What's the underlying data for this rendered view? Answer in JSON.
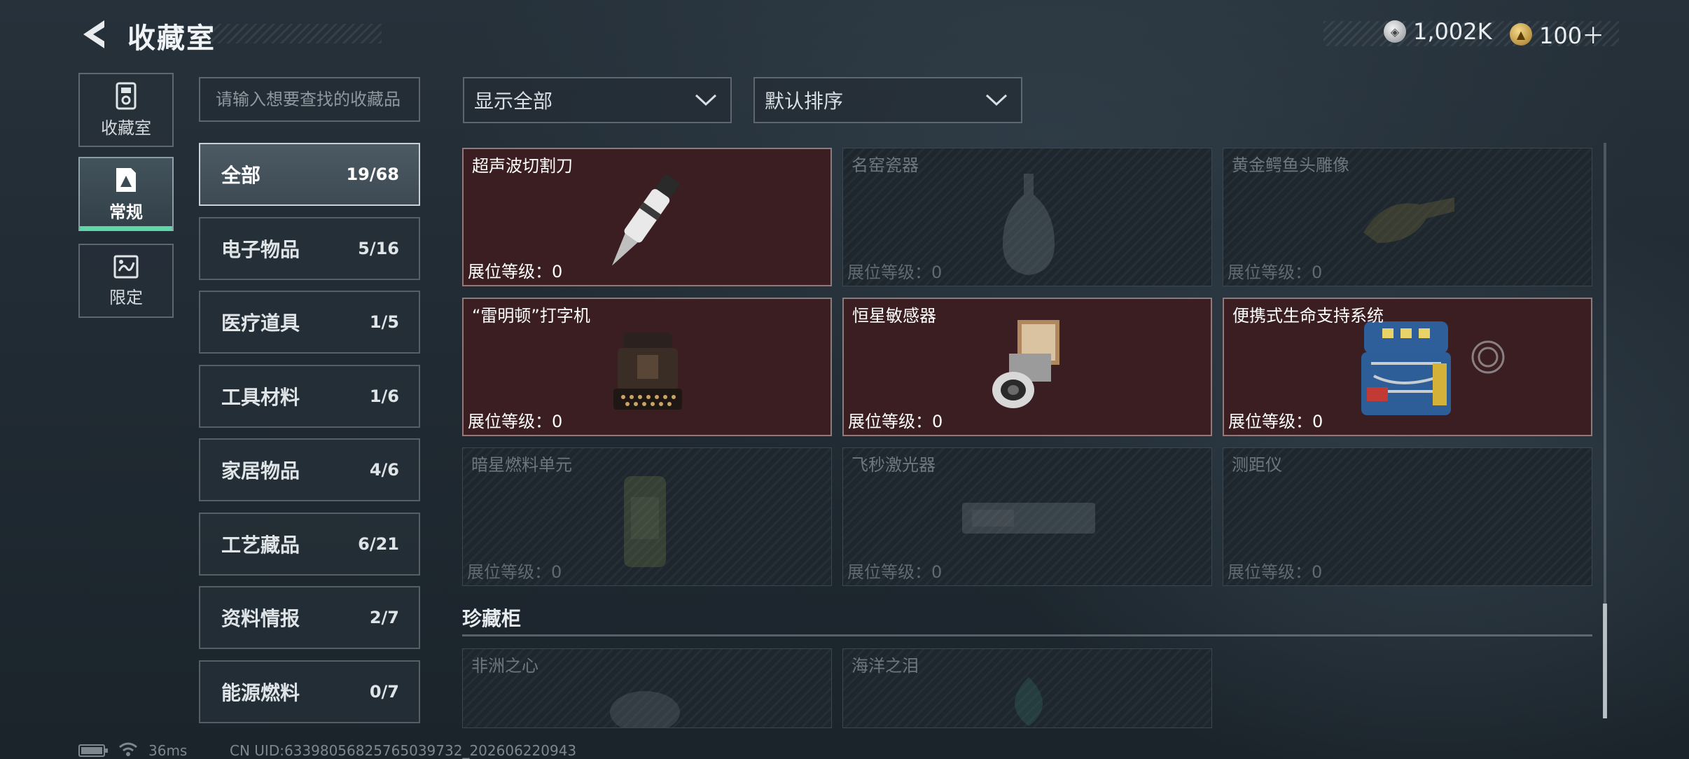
{
  "header": {
    "title": "收藏室",
    "back_icon": "chevron-left-icon"
  },
  "currency": [
    {
      "icon": "silver-coin-icon",
      "value": "1,002K"
    },
    {
      "icon": "gold-coin-icon",
      "value": "100＋"
    }
  ],
  "rail": [
    {
      "label": "收藏室",
      "icon": "collection-room-icon",
      "active": false
    },
    {
      "label": "常规",
      "icon": "regular-card-icon",
      "active": true
    },
    {
      "label": "限定",
      "icon": "limited-card-icon",
      "active": false
    }
  ],
  "search": {
    "placeholder": "请输入想要查找的收藏品",
    "value": ""
  },
  "categories": [
    {
      "name": "全部",
      "count": "19/68",
      "active": true
    },
    {
      "name": "电子物品",
      "count": "5/16"
    },
    {
      "name": "医疗道具",
      "count": "1/5"
    },
    {
      "name": "工具材料",
      "count": "1/6"
    },
    {
      "name": "家居物品",
      "count": "4/6"
    },
    {
      "name": "工艺藏品",
      "count": "6/21"
    },
    {
      "name": "资料情报",
      "count": "2/7"
    },
    {
      "name": "能源燃料",
      "count": "0/7"
    }
  ],
  "filters": {
    "show": "显示全部",
    "sort": "默认排序"
  },
  "items": [
    {
      "name": "超声波切割刀",
      "level": "展位等级：0",
      "owned": true
    },
    {
      "name": "名窑瓷器",
      "level": "展位等级：0",
      "owned": false
    },
    {
      "name": "黄金鳄鱼头雕像",
      "level": "展位等级：0",
      "owned": false
    },
    {
      "name": "“雷明顿”打字机",
      "level": "展位等级：0",
      "owned": true
    },
    {
      "name": "恒星敏感器",
      "level": "展位等级：0",
      "owned": true
    },
    {
      "name": "便携式生命支持系统",
      "level": "展位等级：0",
      "owned": true
    },
    {
      "name": "暗星燃料单元",
      "level": "展位等级：0",
      "owned": false
    },
    {
      "name": "飞秒激光器",
      "level": "展位等级：0",
      "owned": false
    },
    {
      "name": "测距仪",
      "level": "展位等级：0",
      "owned": false
    }
  ],
  "treasure": {
    "title": "珍藏柜",
    "items": [
      {
        "name": "非洲之心",
        "owned": false
      },
      {
        "name": "海洋之泪",
        "owned": false
      }
    ]
  },
  "footer": {
    "ping": "36ms",
    "uid": "CN UID:63398056825765039732_202606220943"
  },
  "colors": {
    "owned_card": "#3b1e21",
    "accent_tab": "#5fd6a8",
    "locked_card": "#1e272e"
  }
}
